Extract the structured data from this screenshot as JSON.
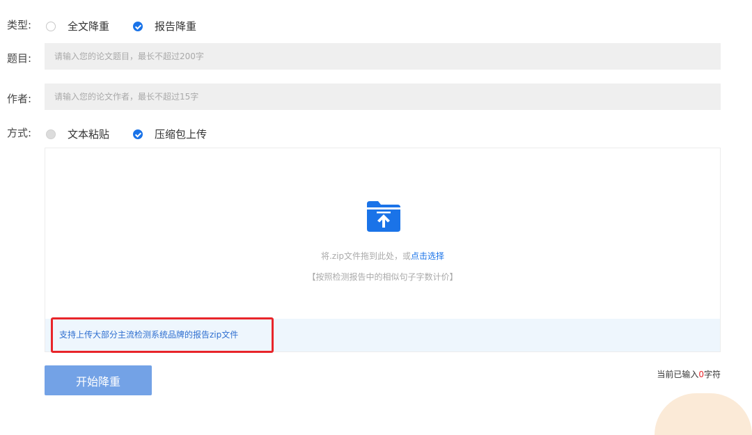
{
  "type_row": {
    "label": "类型:",
    "options": [
      {
        "label": "全文降重",
        "checked": false
      },
      {
        "label": "报告降重",
        "checked": true
      }
    ]
  },
  "title_row": {
    "label": "题目:",
    "placeholder": "请输入您的论文题目，最长不超过200字"
  },
  "author_row": {
    "label": "作者:",
    "placeholder": "请输入您的论文作者，最长不超过15字"
  },
  "method_row": {
    "label": "方式:",
    "options": [
      {
        "label": "文本粘贴",
        "checked": false
      },
      {
        "label": "压缩包上传",
        "checked": true
      }
    ]
  },
  "upload": {
    "icon": "folder-upload-icon",
    "hint_prefix": "将.zip文件拖到此处，或",
    "hint_link": "点击选择",
    "pricing_note": "【按照检测报告中的相似句子字数计价】",
    "footer_note": "支持上传大部分主流检测系统品牌的报告zip文件"
  },
  "actions": {
    "start_button": "开始降重"
  },
  "counter": {
    "prefix": "当前已输入",
    "count": "0",
    "suffix": "字符"
  },
  "colors": {
    "accent": "#1a73e8",
    "button": "#73a2e6",
    "highlight_box": "#e8252a",
    "footer_bar": "#eef6fd"
  }
}
